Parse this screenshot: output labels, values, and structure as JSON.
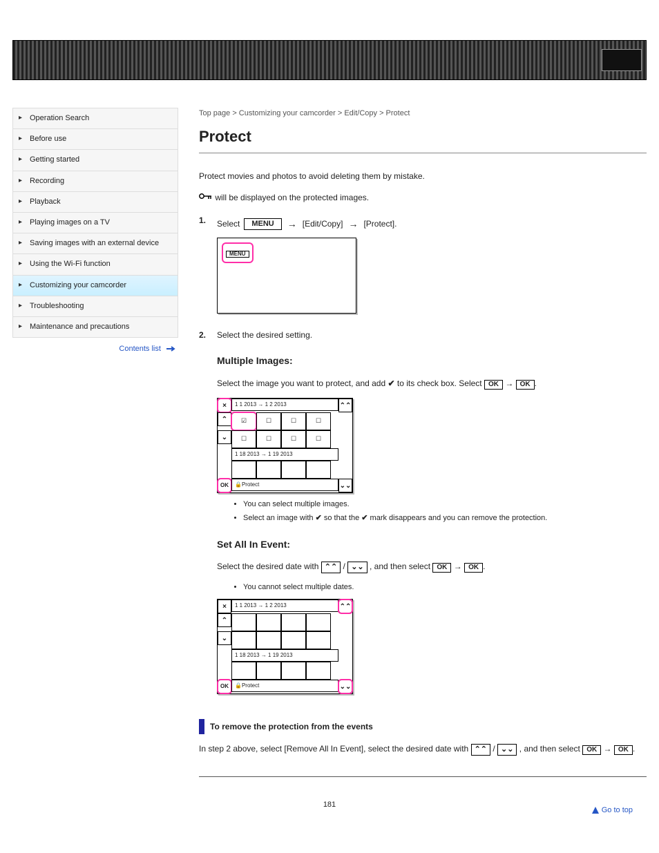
{
  "banner": {
    "title": ""
  },
  "sidebar": {
    "items": [
      "Operation Search",
      "Before use",
      "Getting started",
      "Recording",
      "Playback",
      "Playing images on a TV",
      "Saving images with an external device",
      "Using the Wi-Fi function",
      "Customizing your camcorder",
      "Troubleshooting",
      "Maintenance and precautions"
    ],
    "active_index": 8,
    "toplink": "Contents list"
  },
  "main": {
    "breadcrumb": "Top page > Customizing your camcorder > Edit/Copy > Protect",
    "title": "Protect",
    "intro": "Protect movies and photos to avoid deleting them by mistake.",
    "key_label": " will be displayed on the protected images.",
    "steps": {
      "s1": {
        "num": "1.",
        "text": "Select         →  [Edit/Copy]  →  [Protect].",
        "menu": "MENU"
      },
      "s2": {
        "num": "2.",
        "text_pre": "Select the desired setting.",
        "opt1": {
          "label": "Multiple Images:",
          "desc": "Select the image you want to protect, and add      to its check box. Select                →           ."
        },
        "opt2bullet1": "You can select multiple images.",
        "opt2bullet2": "Select an image with      so that the      mark disappears and you can remove the protection.",
        "opt3": {
          "label": "Set All In Event:",
          "desc_a": "Select the desired date with          /          , and then select              →            .",
          "bullet": "You cannot select multiple dates."
        }
      }
    },
    "grid": {
      "date1": "1 1 2013 → 1 2 2013",
      "date2": "1 18 2013 → 1 19 2013",
      "protect": "Protect",
      "ok": "OK"
    },
    "section2": {
      "title": "To remove the protection from the events",
      "line1": "In step 2 above, select [Remove All In Event], select the desired date with",
      "line2": " /        , and then select             →           ."
    },
    "buttons": {
      "ok": "OK",
      "menu": "MENU"
    },
    "gotop": "Go to top"
  },
  "pagenum": "181"
}
